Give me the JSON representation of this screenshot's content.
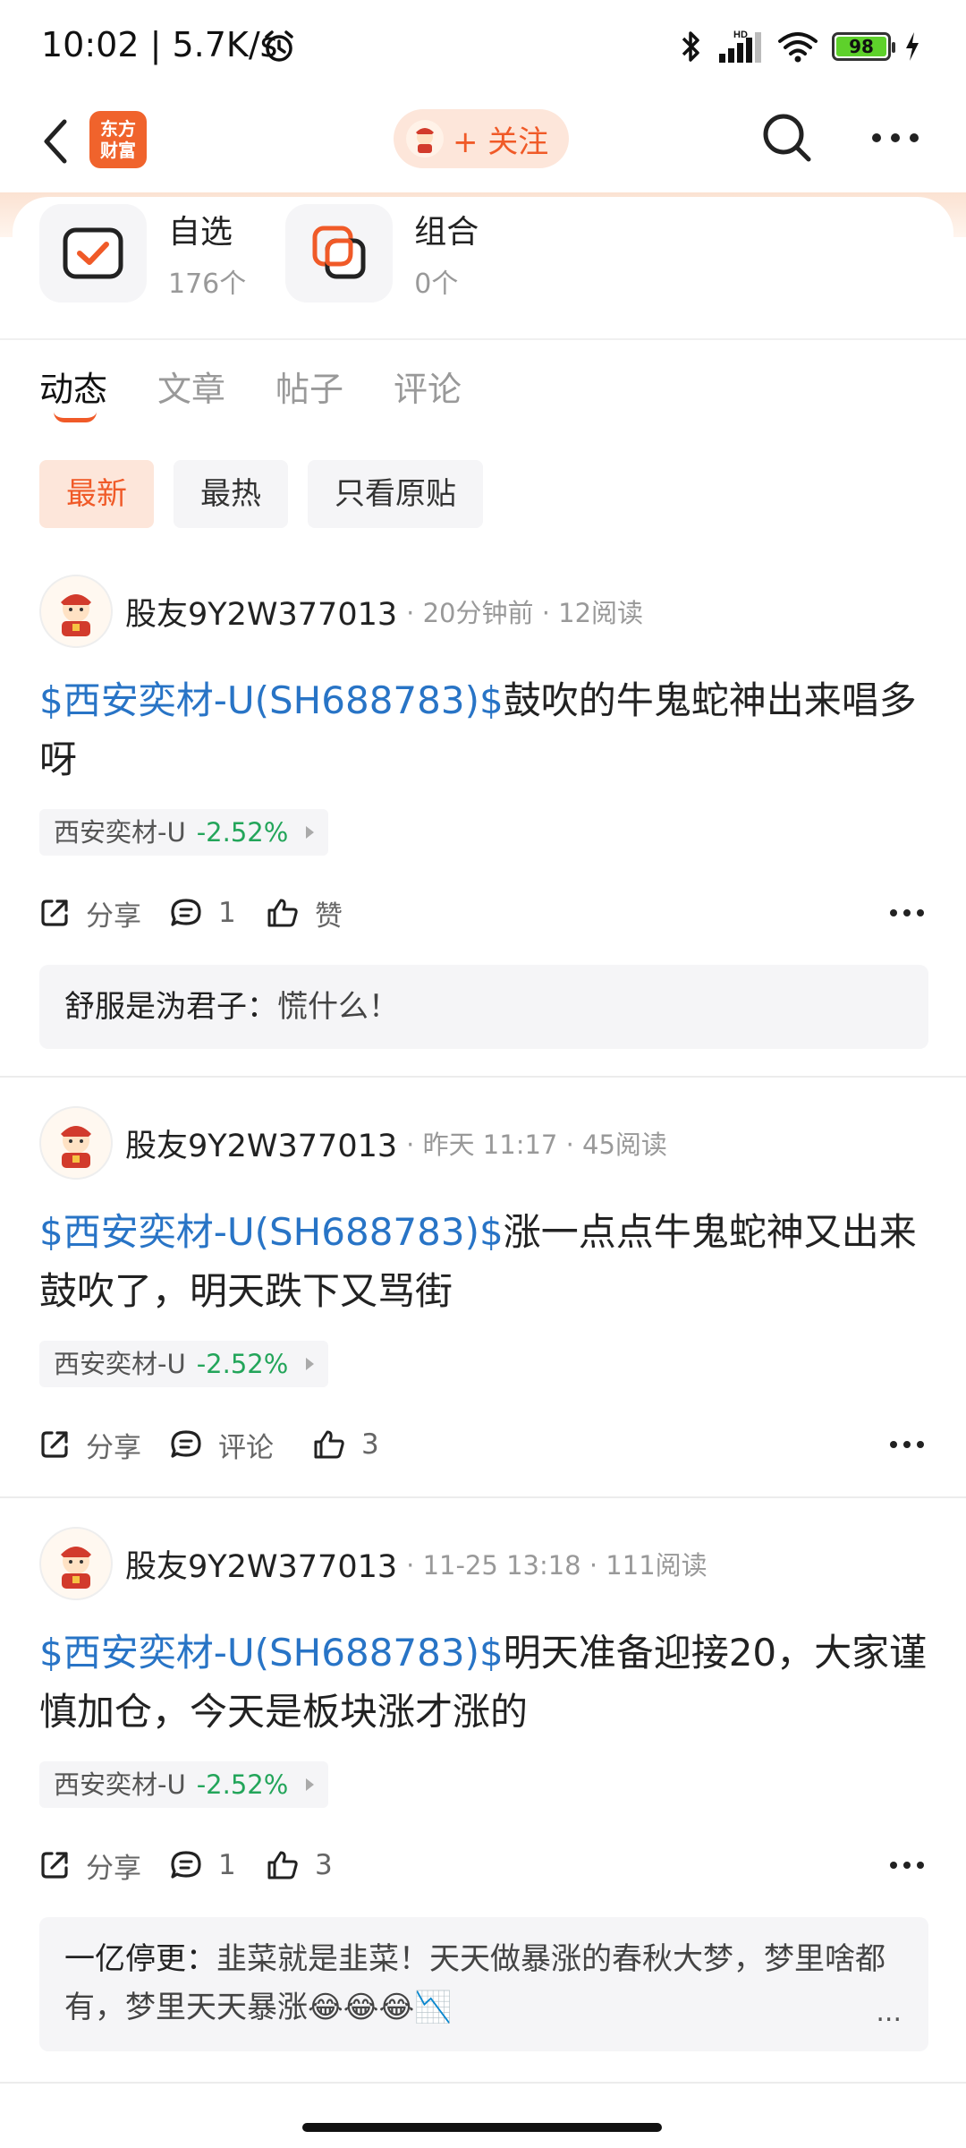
{
  "status_bar": {
    "time": "10:02",
    "speed": "5.7K/s",
    "battery": "98",
    "hd": "HD"
  },
  "header": {
    "app_logo": "东方\n财富",
    "follow_label": "+ 关注"
  },
  "shortcuts": [
    {
      "title": "自选",
      "count": "176个"
    },
    {
      "title": "组合",
      "count": "0个"
    }
  ],
  "tabs": [
    "动态",
    "文章",
    "帖子",
    "评论"
  ],
  "filters": [
    "最新",
    "最热",
    "只看原贴"
  ],
  "posts": [
    {
      "author": "股友9Y2W377013",
      "time": "20分钟前",
      "reads": "12阅读",
      "stock_link": "$西安奕材-U(SH688783)$",
      "text": "鼓吹的牛鬼蛇神出来唱多呀",
      "tag_name": "西安奕材-U",
      "tag_pct": "-2.52%",
      "share": "分享",
      "comments": "1",
      "likes": "赞",
      "reply_user": "舒服是沩君子：",
      "reply_text": "慌什么！"
    },
    {
      "author": "股友9Y2W377013",
      "time": "昨天 11:17",
      "reads": "45阅读",
      "stock_link": "$西安奕材-U(SH688783)$",
      "text": "涨一点点牛鬼蛇神又出来鼓吹了，明天跌下又骂街",
      "tag_name": "西安奕材-U",
      "tag_pct": "-2.52%",
      "share": "分享",
      "comments": "评论",
      "likes": "3"
    },
    {
      "author": "股友9Y2W377013",
      "time": "11-25 13:18",
      "reads": "111阅读",
      "stock_link": "$西安奕材-U(SH688783)$",
      "text": "明天准备迎接20，大家谨慎加仓，今天是板块涨才涨的",
      "tag_name": "西安奕材-U",
      "tag_pct": "-2.52%",
      "share": "分享",
      "comments": "1",
      "likes": "3",
      "reply_user": "一亿停更：",
      "reply_text": "韭菜就是韭菜！天天做暴涨的春秋大梦，梦里啥都有，梦里天天暴涨😂😂😂📉",
      "reply_more": "..."
    }
  ],
  "colors": {
    "accent": "#f05a28",
    "stock_link": "#2874c6",
    "down_pct": "#23a55a"
  }
}
